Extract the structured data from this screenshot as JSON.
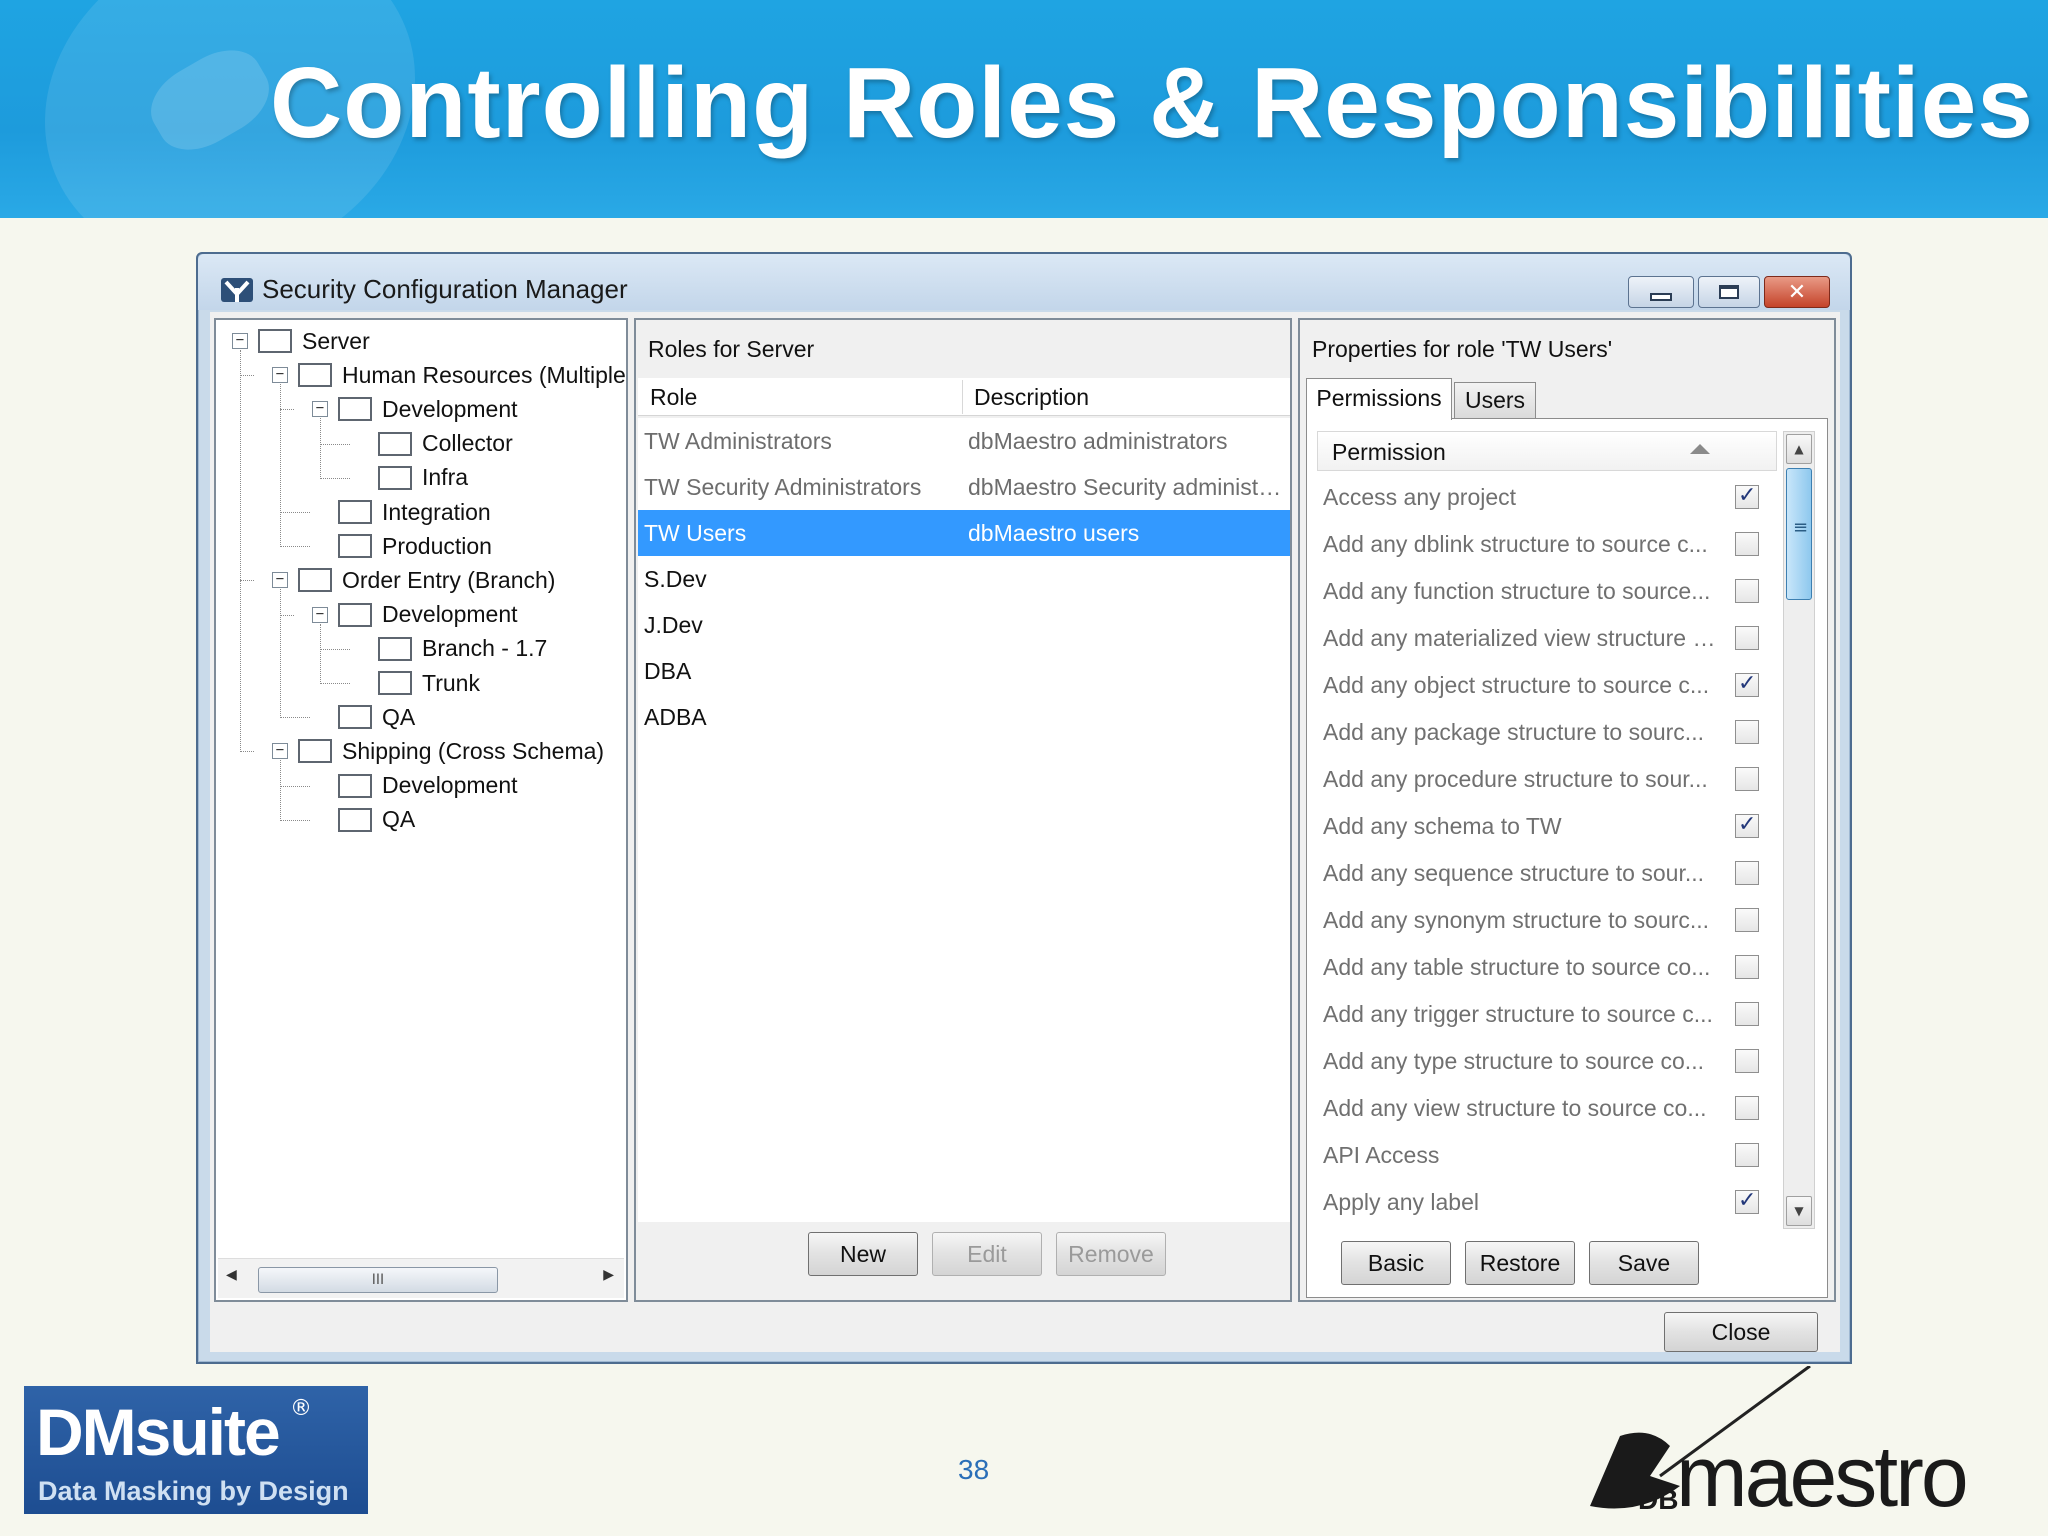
{
  "slide": {
    "title": "Controlling Roles & Responsibilities",
    "page_number": "38",
    "logo_left_main": "DMsuite",
    "logo_left_reg": "®",
    "logo_left_sub": "Data Masking by Design",
    "logo_right_prefix": "DB",
    "logo_right_name": "maestro"
  },
  "window": {
    "title": "Security Configuration Manager",
    "close_label": "Close"
  },
  "tree": {
    "nodes": [
      {
        "label": "Server"
      },
      {
        "label": "Human Resources (Multiple"
      },
      {
        "label": "Development"
      },
      {
        "label": "Collector"
      },
      {
        "label": "Infra"
      },
      {
        "label": "Integration"
      },
      {
        "label": "Production"
      },
      {
        "label": "Order Entry (Branch)"
      },
      {
        "label": "Development"
      },
      {
        "label": "Branch - 1.7"
      },
      {
        "label": "Trunk"
      },
      {
        "label": "QA"
      },
      {
        "label": "Shipping (Cross Schema)"
      },
      {
        "label": "Development"
      },
      {
        "label": "QA"
      }
    ],
    "scroll_thumb": "III"
  },
  "roles": {
    "title": "Roles for Server",
    "col_role": "Role",
    "col_description": "Description",
    "rows": [
      {
        "role": "TW Administrators",
        "description": "dbMaestro administrators"
      },
      {
        "role": "TW Security Administrators",
        "description": "dbMaestro Security administrators"
      },
      {
        "role": "TW Users",
        "description": "dbMaestro users"
      },
      {
        "role": "S.Dev",
        "description": ""
      },
      {
        "role": "J.Dev",
        "description": ""
      },
      {
        "role": "DBA",
        "description": ""
      },
      {
        "role": "ADBA",
        "description": ""
      }
    ],
    "selected_index": 2,
    "btn_new": "New",
    "btn_edit": "Edit",
    "btn_remove": "Remove"
  },
  "properties": {
    "title": "Properties for role 'TW Users'",
    "tab_permissions": "Permissions",
    "tab_users": "Users",
    "col_permission": "Permission",
    "permissions": [
      {
        "label": "Access any project",
        "checked": true
      },
      {
        "label": "Add any dblink structure to source c...",
        "checked": false
      },
      {
        "label": "Add any function structure to source...",
        "checked": false
      },
      {
        "label": "Add any materialized view structure t...",
        "checked": false
      },
      {
        "label": "Add any object structure to source c...",
        "checked": true
      },
      {
        "label": "Add any package structure to sourc...",
        "checked": false
      },
      {
        "label": "Add any procedure structure to sour...",
        "checked": false
      },
      {
        "label": "Add any schema to TW",
        "checked": true
      },
      {
        "label": "Add any sequence structure to sour...",
        "checked": false
      },
      {
        "label": "Add any synonym structure to sourc...",
        "checked": false
      },
      {
        "label": "Add any table structure to source co...",
        "checked": false
      },
      {
        "label": "Add any trigger structure to source c...",
        "checked": false
      },
      {
        "label": "Add any type structure to source co...",
        "checked": false
      },
      {
        "label": "Add any view structure to source co...",
        "checked": false
      },
      {
        "label": "API Access",
        "checked": false
      },
      {
        "label": "Apply any label",
        "checked": true
      }
    ],
    "btn_basic": "Basic",
    "btn_restore": "Restore",
    "btn_save": "Save"
  },
  "colors": {
    "banner": "#1d9bdc",
    "selection": "#3399ff",
    "check": "#23387a"
  }
}
